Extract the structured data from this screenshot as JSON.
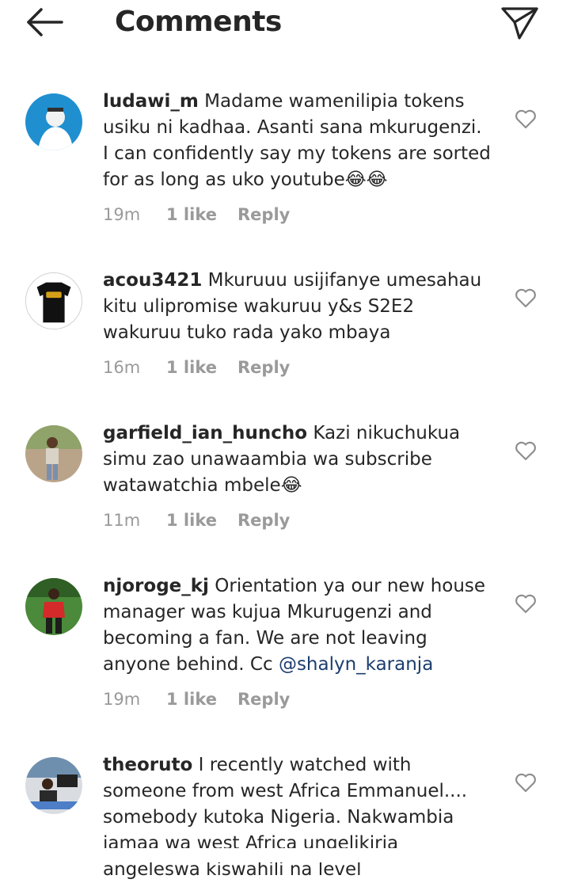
{
  "header": {
    "title": "Comments",
    "back_icon": "arrow-left-icon",
    "share_icon": "paper-plane-icon"
  },
  "comments": [
    {
      "username": "ludawi_m",
      "text": "Madame wamenilipia tokens usiku ni kadhaa. Asanti sana mkurugenzi. I can confidently say my tokens are sorted for as long as uko youtube😂😂",
      "time": "19m",
      "likes": "1 like",
      "reply": "Reply",
      "avatar_color": "#1f8fd0"
    },
    {
      "username": "acou3421",
      "text": "Mkuruuu usijifanye umesahau kitu ulipromise wakuruu y&s S2E2 wakuruu tuko rada yako mbaya",
      "time": "16m",
      "likes": "1 like",
      "reply": "Reply",
      "avatar_color": "#111111"
    },
    {
      "username": "garfield_ian_huncho",
      "text": "Kazi nikuchukua simu zao unawaambia wa subscribe watawatchia mbele😂",
      "time": "11m",
      "likes": "1 like",
      "reply": "Reply",
      "avatar_color": "#b9a48a"
    },
    {
      "username": "njoroge_kj",
      "text": "Orientation ya our new house manager was kujua Mkurugenzi and becoming a fan. We are not leaving anyone behind. Cc ",
      "mention": "@shalyn_karanja",
      "time": "19m",
      "likes": "1 like",
      "reply": "Reply",
      "avatar_color": "#4a8a3a"
    },
    {
      "username": "theoruto",
      "text": "I recently watched with someone from west Africa Emmanuel.... somebody kutoka Nigeria. Nakwambia jamaa wa west Africa ungelikiria angeleswa kiswahili na level",
      "time": "",
      "likes": "",
      "reply": "",
      "avatar_color": "#6f8fae"
    }
  ],
  "icons": {
    "like": "heart-outline-icon"
  },
  "colors": {
    "text": "#262626",
    "meta": "#9a9a9a",
    "mention": "#1b3e6f"
  }
}
